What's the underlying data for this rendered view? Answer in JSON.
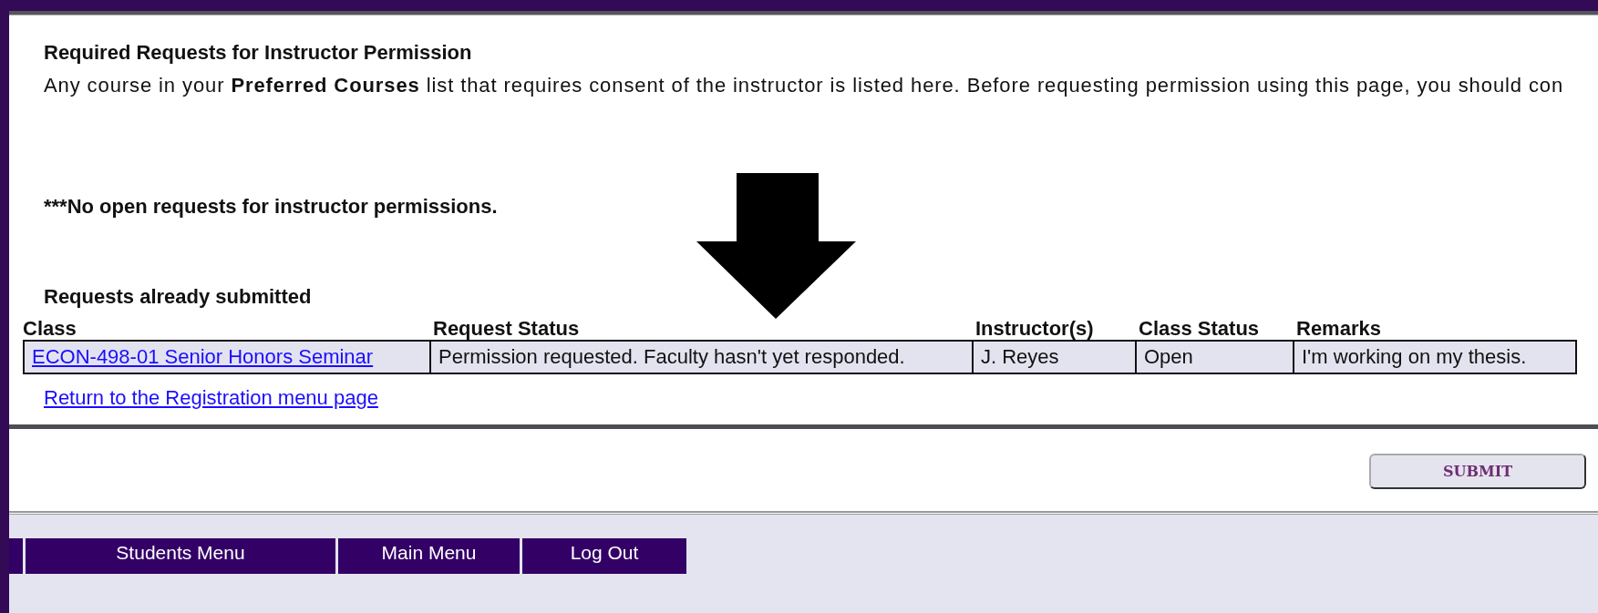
{
  "heading": "Required Requests for Instructor Permission",
  "intro": "Any course in your **Preferred Courses** list that requires consent of the instructor is listed here. Before requesting permission using this page, you should con",
  "no_open_message": "***No open requests for instructor permissions.",
  "submitted": {
    "title": "Requests already submitted",
    "columns": [
      "Class",
      "Request Status",
      "Instructor(s)",
      "Class Status",
      "Remarks"
    ],
    "rows": [
      {
        "class": "ECON-498-01 Senior Honors Seminar",
        "request_status": "Permission requested. Faculty hasn't yet responded.",
        "instructors": "J. Reyes",
        "class_status": "Open",
        "remarks": "I'm working on my thesis."
      }
    ]
  },
  "return_link": "Return to the Registration menu page",
  "submit_button": "SUBMIT",
  "menu": [
    {
      "label": "Students Menu"
    },
    {
      "label": "Main Menu"
    },
    {
      "label": "Log Out"
    }
  ]
}
